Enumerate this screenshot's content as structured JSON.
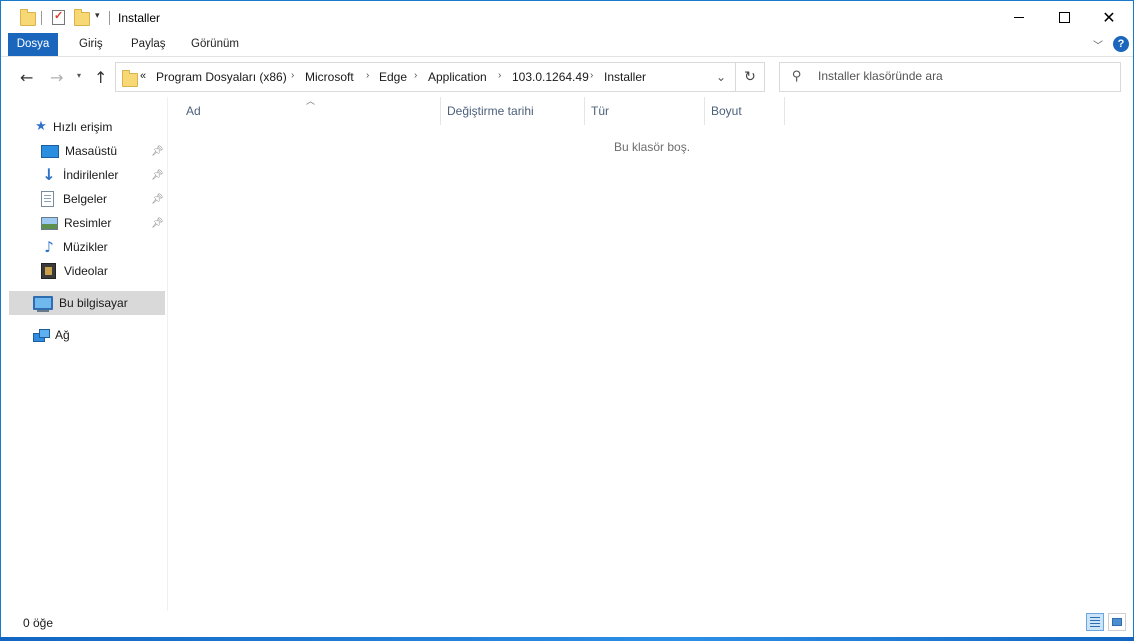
{
  "window": {
    "title": "Installer"
  },
  "ribbon": {
    "tabs": [
      {
        "label": "Dosya"
      },
      {
        "label": "Giriş"
      },
      {
        "label": "Paylaş"
      },
      {
        "label": "Görünüm"
      }
    ]
  },
  "address": {
    "overflow": "«",
    "crumbs": [
      "Program Dosyaları (x86)",
      "Microsoft",
      "Edge",
      "Application",
      "103.0.1264.49",
      "Installer"
    ]
  },
  "search": {
    "placeholder": "Installer klasöründe ara"
  },
  "sidebar": {
    "quick_access": "Hızlı erişim",
    "items": [
      {
        "label": "Masaüstü",
        "icon": "desktop-icon",
        "pinned": true
      },
      {
        "label": "İndirilenler",
        "icon": "downloads-icon",
        "pinned": true
      },
      {
        "label": "Belgeler",
        "icon": "documents-icon",
        "pinned": true
      },
      {
        "label": "Resimler",
        "icon": "pictures-icon",
        "pinned": true
      },
      {
        "label": "Müzikler",
        "icon": "music-icon",
        "pinned": false
      },
      {
        "label": "Videolar",
        "icon": "videos-icon",
        "pinned": false
      }
    ],
    "this_pc": "Bu bilgisayar",
    "network": "Ağ"
  },
  "columns": [
    "Ad",
    "Değiştirme tarihi",
    "Tür",
    "Boyut"
  ],
  "content": {
    "empty_message": "Bu klasör boş."
  },
  "status": {
    "item_count": "0 öğe"
  },
  "colors": {
    "accent": "#1a66bd",
    "selected_bg": "#d9d9d9",
    "column_text": "#4c607a"
  }
}
